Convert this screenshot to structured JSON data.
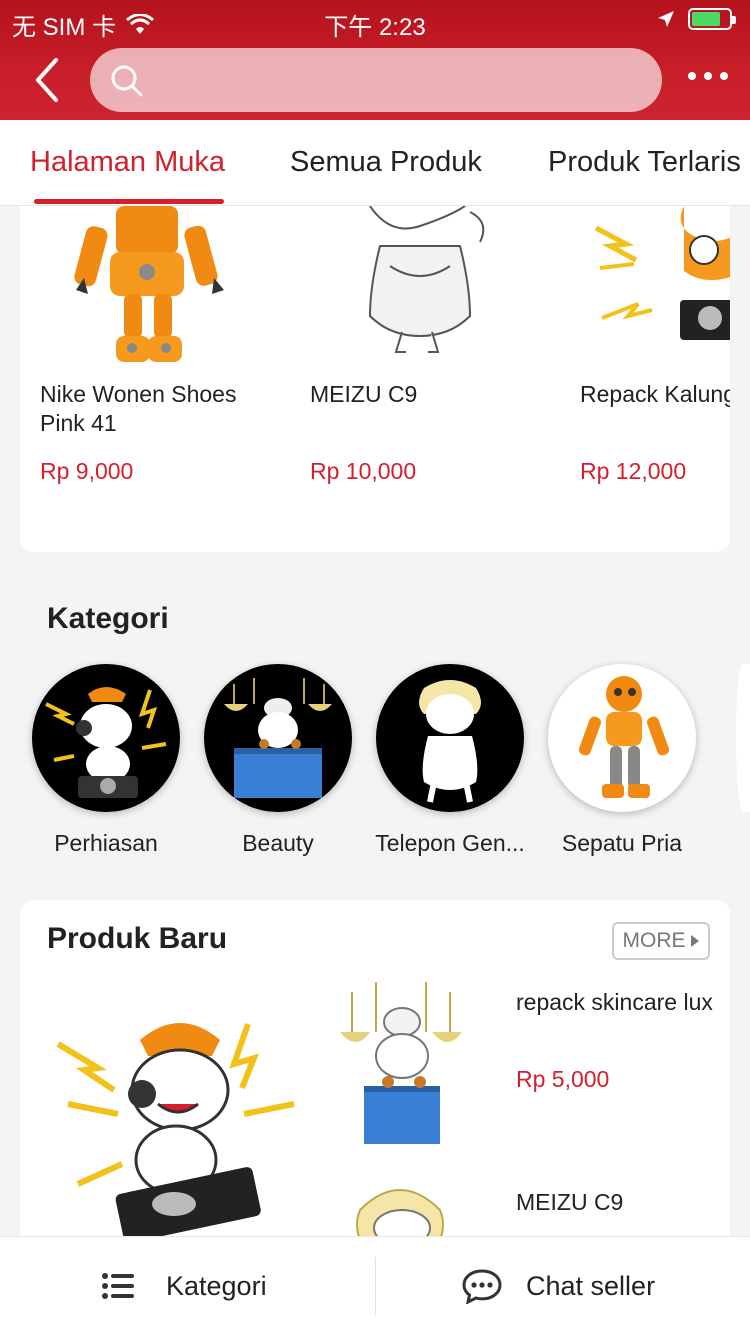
{
  "status_bar": {
    "carrier": "无 SIM 卡",
    "time": "下午 2:23"
  },
  "search": {
    "placeholder": ""
  },
  "tabs": [
    {
      "label": "Halaman Muka",
      "active": true
    },
    {
      "label": "Semua Produk",
      "active": false
    },
    {
      "label": "Produk Terlaris",
      "active": false
    }
  ],
  "top_products": [
    {
      "name": "Nike Wonen Shoes Pink 41",
      "price": "Rp 9,000",
      "image": "orange-robot"
    },
    {
      "name": "MEIZU C9",
      "price": "Rp 10,000",
      "image": "marilyn-unicorn"
    },
    {
      "name": "Repack Kalung",
      "price": "Rp 12,000",
      "image": "dj-unicorn"
    }
  ],
  "kategori": {
    "title": "Kategori",
    "items": [
      {
        "label": "Perhiasan",
        "image": "dj-unicorn"
      },
      {
        "label": "Beauty",
        "image": "chandelier-unicorn"
      },
      {
        "label": "Telepon Gen...",
        "image": "marilyn-unicorn"
      },
      {
        "label": "Sepatu Pria",
        "image": "orange-robot"
      }
    ]
  },
  "produk_baru": {
    "title": "Produk Baru",
    "more_label": "MORE",
    "items": [
      {
        "name": "repack skincare lux",
        "price": "Rp 5,000",
        "image": "chandelier-unicorn"
      },
      {
        "name": "MEIZU C9",
        "price": "",
        "image": "marilyn-unicorn"
      }
    ]
  },
  "bottom_bar": {
    "kategori_label": "Kategori",
    "chat_label": "Chat seller"
  },
  "colors": {
    "brand_red": "#d4202c",
    "header_red": "#c81f29"
  }
}
